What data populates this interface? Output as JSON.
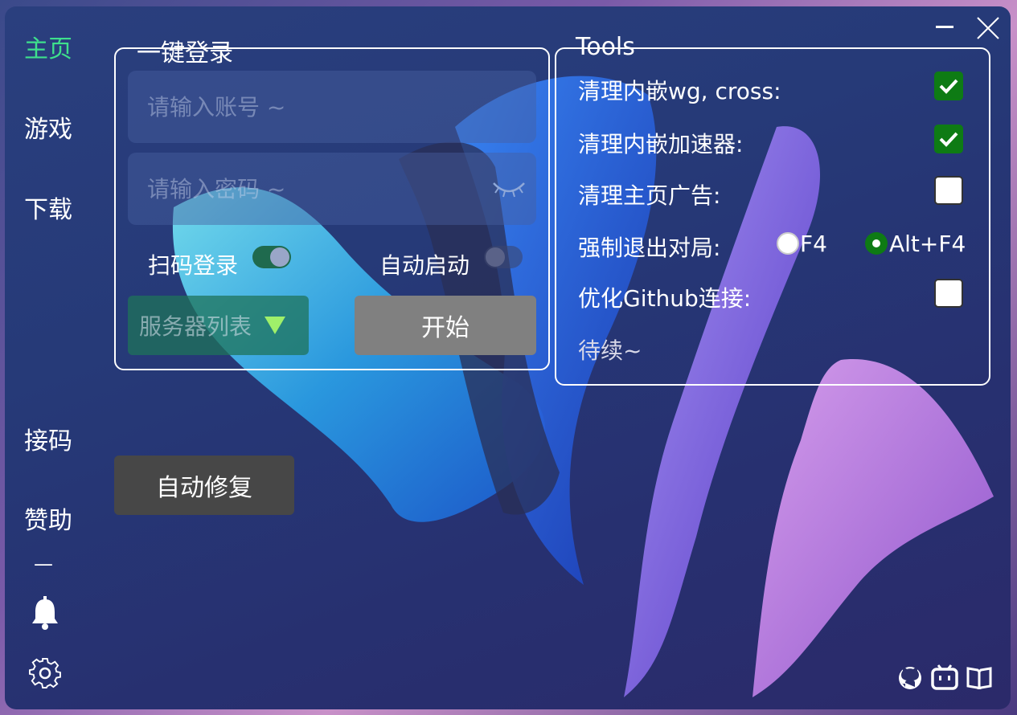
{
  "nav": {
    "items": [
      {
        "label": "主页",
        "active": true
      },
      {
        "label": "游戏"
      },
      {
        "label": "下载"
      },
      {
        "label": "接码"
      },
      {
        "label": "赞助"
      }
    ],
    "divider": "—",
    "bell_icon": "bell-icon",
    "settings_icon": "gear-icon"
  },
  "window_controls": {
    "minimize": "—",
    "close_icon": "close-icon"
  },
  "login": {
    "title": "一键登录",
    "account_placeholder": "请输入账号 ~",
    "password_placeholder": "请输入密码 ~",
    "eye_icon": "eye-closed-icon",
    "qr_login_label": "扫码登录",
    "qr_login_on": true,
    "auto_start_label": "自动启动",
    "auto_start_on": false,
    "server_list_label": "服务器列表",
    "start_label": "开始"
  },
  "repair_label": "自动修复",
  "tools": {
    "title": "Tools",
    "items": [
      {
        "label": "清理内嵌wg, cross:",
        "checked": true
      },
      {
        "label": "清理内嵌加速器:",
        "checked": true
      },
      {
        "label": "清理主页广告:",
        "checked": false
      }
    ],
    "force_exit": {
      "label": "强制退出对局:",
      "options": [
        "F4",
        "Alt+F4"
      ],
      "selected": "Alt+F4"
    },
    "github": {
      "label": "优化Github连接:",
      "checked": false
    },
    "more": "待续~"
  },
  "footer_icons": [
    "github-icon",
    "bilibili-icon",
    "book-icon"
  ],
  "colors": {
    "accent_green": "#3ee08c",
    "check_green": "#0e7b14",
    "gray_button": "#808080",
    "dark_button": "#474747"
  }
}
